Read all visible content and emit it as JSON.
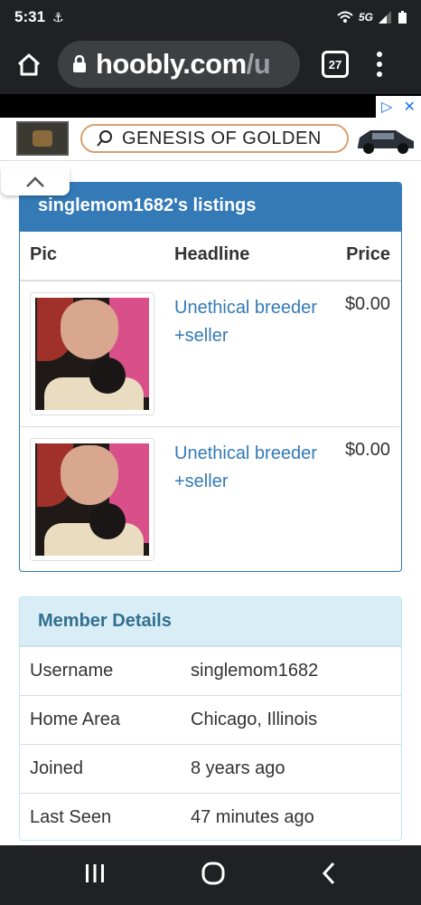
{
  "status_bar": {
    "time": "5:31",
    "network": "5G"
  },
  "browser": {
    "url_domain": "hoobly.com",
    "url_rest": "/u",
    "tab_count": "27"
  },
  "ad": {
    "search_label": "GENESIS OF GOLDEN"
  },
  "listings": {
    "title": "singlemom1682's listings",
    "columns": {
      "pic": "Pic",
      "headline": "Headline",
      "price": "Price"
    },
    "rows": [
      {
        "headline": "Unethical breeder +seller",
        "price": "$0.00"
      },
      {
        "headline": "Unethical breeder +seller",
        "price": "$0.00"
      }
    ]
  },
  "member": {
    "title": "Member Details",
    "rows": [
      {
        "label": "Username",
        "value": "singlemom1682"
      },
      {
        "label": "Home Area",
        "value": "Chicago, Illinois"
      },
      {
        "label": "Joined",
        "value": "8 years ago"
      },
      {
        "label": "Last Seen",
        "value": "47 minutes ago"
      }
    ]
  },
  "colors": {
    "panel_primary": "#337ab7",
    "panel_info": "#d9edf7",
    "link": "#337ab7"
  }
}
